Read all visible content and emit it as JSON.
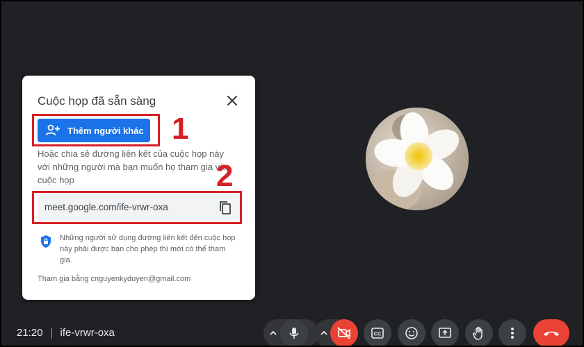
{
  "dialog": {
    "title": "Cuộc họp đã sẵn sàng",
    "add_button_label": "Thêm người khác",
    "description": "Hoặc chia sẻ đường liên kết của cuộc họp này với những người mà bạn muốn họ tham gia vào cuộc họp",
    "meeting_link": "meet.google.com/ife-vrwr-oxa",
    "security_note": "Những người sử dụng đường liên kết đến cuộc họp này phải được bạn cho phép thì mới có thể tham gia.",
    "joined_as": "Tham gia bằng cnguyenkyduyen@gmail.com"
  },
  "annotations": {
    "step1": "1",
    "step2": "2"
  },
  "bottom_bar": {
    "time": "21:20",
    "meeting_code": "ife-vrwr-oxa",
    "icons": [
      "caret-up-icon",
      "microphone-icon",
      "camera-off-icon",
      "captions-icon",
      "emoji-icon",
      "present-screen-icon",
      "raise-hand-icon",
      "more-options-icon",
      "end-call-icon"
    ]
  },
  "colors": {
    "background": "#202124",
    "primary": "#1a73e8",
    "annotation": "#d61f26",
    "end_call": "#ea4335"
  }
}
